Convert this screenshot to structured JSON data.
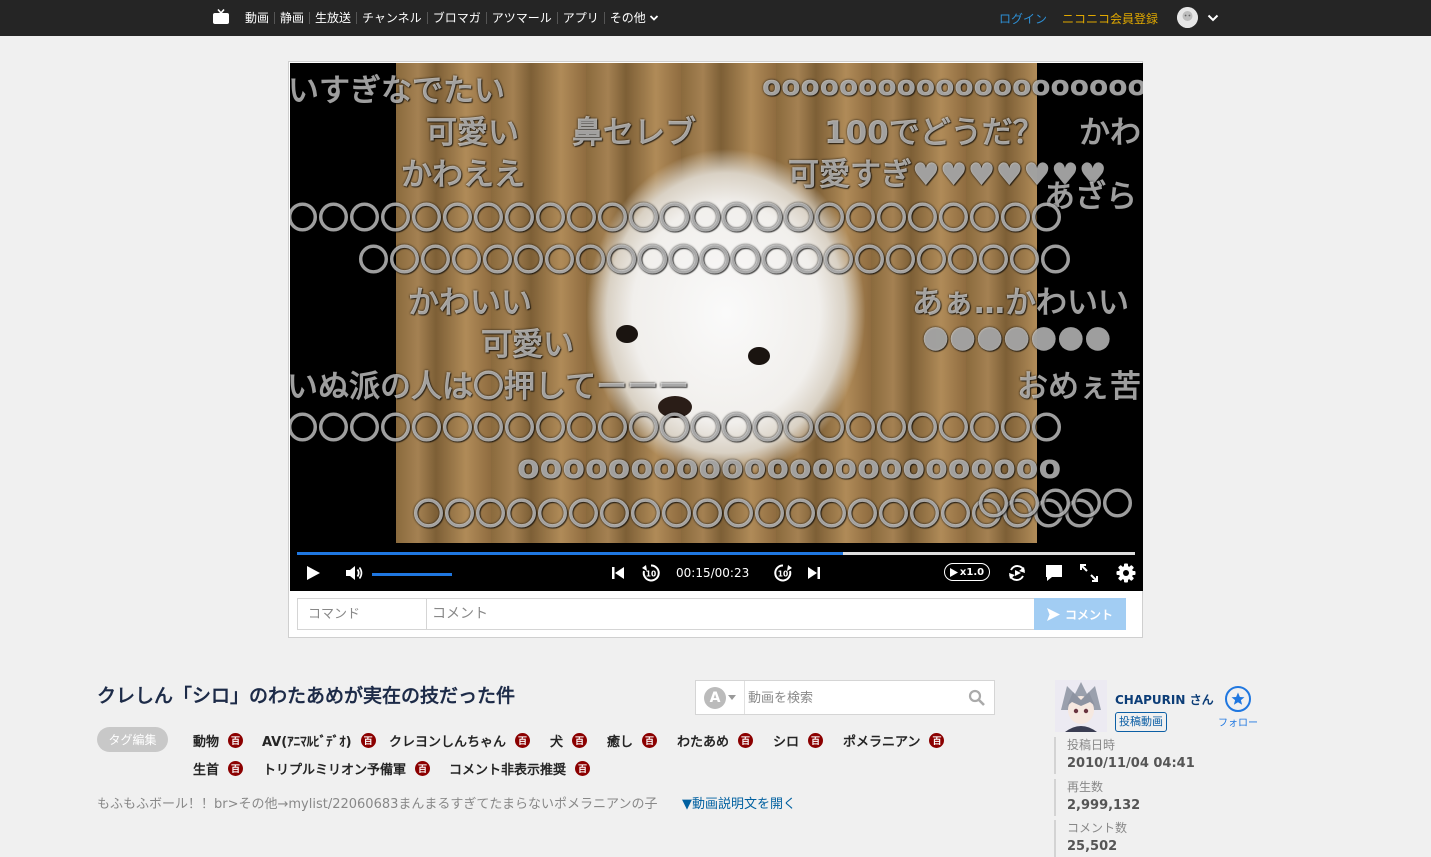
{
  "nav": {
    "items": [
      "動画",
      "静画",
      "生放送",
      "チャンネル",
      "ブロマガ",
      "アツマール",
      "アプリ"
    ],
    "more_label": "その他",
    "login": "ログイン",
    "register": "ニコニコ会員登録"
  },
  "player": {
    "comments": [
      "いすぎなでたい",
      "oooooooooooooooooooo",
      "可愛い",
      "鼻セレブ",
      "100でどうだ？",
      "かわ",
      "かわええ",
      "可愛すぎ♥♥♥♥♥♥♥",
      "あざら",
      "〇〇〇〇〇〇〇〇〇〇〇〇〇〇〇〇〇〇〇〇〇〇〇〇〇",
      "〇〇〇〇〇〇〇〇〇〇〇〇〇〇〇〇〇〇〇〇〇〇〇",
      "かわいい",
      "あぁ…かわいい",
      "可愛い",
      "●●●●●●●",
      "いぬ派の人は〇押してーーー",
      "おめぇ苦",
      "〇〇〇〇〇〇〇〇〇〇〇〇〇〇〇〇〇〇〇〇〇〇〇〇〇",
      "oooooooooooooooooooooooo",
      "〇〇〇〇〇〇〇〇〇〇〇〇〇〇〇〇〇〇〇〇〇〇",
      "〇〇〇〇〇"
    ],
    "progress": 0.652,
    "volume": 1.0,
    "time": "00:15/00:23",
    "speed_label": "x1.0",
    "command_placeholder": "コマンド",
    "comment_placeholder": "コメント",
    "submit_label": "コメント"
  },
  "video": {
    "title": "クレしん「シロ」のわたあめが実在の技だった件",
    "search_placeholder": "動画を検索",
    "search_mode_label": "A",
    "tag_edit_label": "タグ編集",
    "dict_mark": "百",
    "tags": [
      "動物",
      "AV(ｱﾆﾏﾙﾋﾞﾃﾞｵ)",
      "クレヨンしんちゃん",
      "犬",
      "癒し",
      "わたあめ",
      "シロ",
      "ポメラニアン",
      "生首",
      "トリプルミリオン予備軍",
      "コメント非表示推奨"
    ],
    "description": "もふもふボール！！br>その他→mylist/22060683まんまるすぎてたまらないポメラニアンの子",
    "description_open": "▼動画説明文を開く"
  },
  "uploader": {
    "name": "CHAPURIN さん",
    "videos_label": "投稿動画",
    "follow_label": "フォロー"
  },
  "stats": {
    "posted_label": "投稿日時",
    "posted_value": "2010/11/04 04:41",
    "views_label": "再生数",
    "views_value": "2,999,132",
    "comments_label": "コメント数",
    "comments_value": "25,502"
  },
  "colors": {
    "accent": "#1f77e0",
    "nav_bg": "#252525",
    "login": "#2d8fd5",
    "register": "#e0a800",
    "dict": "#8b0000"
  }
}
